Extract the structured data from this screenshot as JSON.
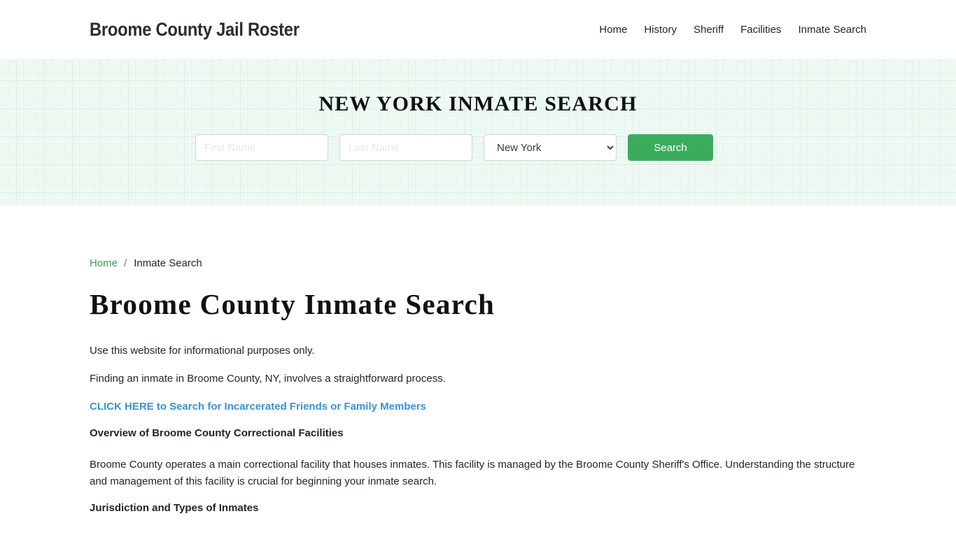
{
  "header": {
    "site_title": "Broome County Jail Roster",
    "nav": [
      {
        "label": "Home"
      },
      {
        "label": "History"
      },
      {
        "label": "Sheriff"
      },
      {
        "label": "Facilities"
      },
      {
        "label": "Inmate Search"
      }
    ]
  },
  "hero": {
    "title": "NEW YORK INMATE SEARCH",
    "first_name_placeholder": "First Name",
    "last_name_placeholder": "Last Name",
    "first_name_value": "",
    "last_name_value": "",
    "state_selected": "New York",
    "search_label": "Search",
    "accent_color": "#3cac5c"
  },
  "breadcrumb": {
    "home": "Home",
    "separator": "/",
    "current": "Inmate Search"
  },
  "main": {
    "title": "Broome County Inmate Search",
    "para1": "Use this website for informational purposes only.",
    "para2": "Finding an inmate in Broome County, NY, involves a straightforward process.",
    "cta_link": "CLICK HERE to Search for Incarcerated Friends or Family Members",
    "heading1": "Overview of Broome County Correctional Facilities",
    "para3": "Broome County operates a main correctional facility that houses inmates. This facility is managed by the Broome County Sheriff's Office. Understanding the structure and management of this facility is crucial for beginning your inmate search.",
    "heading2": "Jurisdiction and Types of Inmates"
  }
}
